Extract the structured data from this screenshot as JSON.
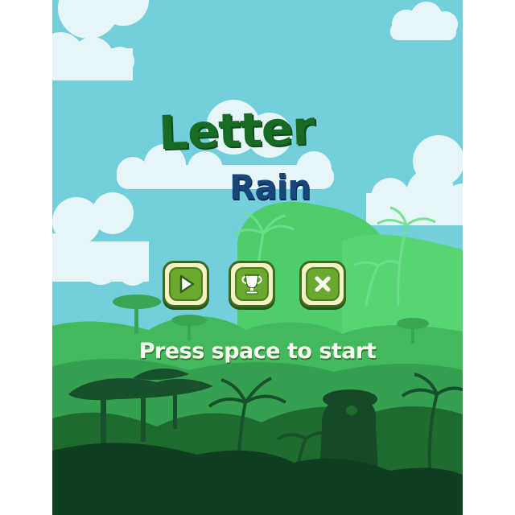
{
  "game": {
    "title_main": "Letter",
    "title_sub": "Rain",
    "start_hint": "Press space to start"
  },
  "menu": {
    "buttons": [
      {
        "id": "play",
        "icon": "play-icon"
      },
      {
        "id": "leaderboard",
        "icon": "trophy-icon"
      },
      {
        "id": "quit",
        "icon": "close-icon"
      }
    ]
  },
  "colors": {
    "sky": "#73cfdc",
    "title_main": "#186b25",
    "title_sub": "#17477a",
    "button_face": "#f5f0c6",
    "button_inner": "#6aa92d",
    "hint_text": "#fbfbf2"
  }
}
